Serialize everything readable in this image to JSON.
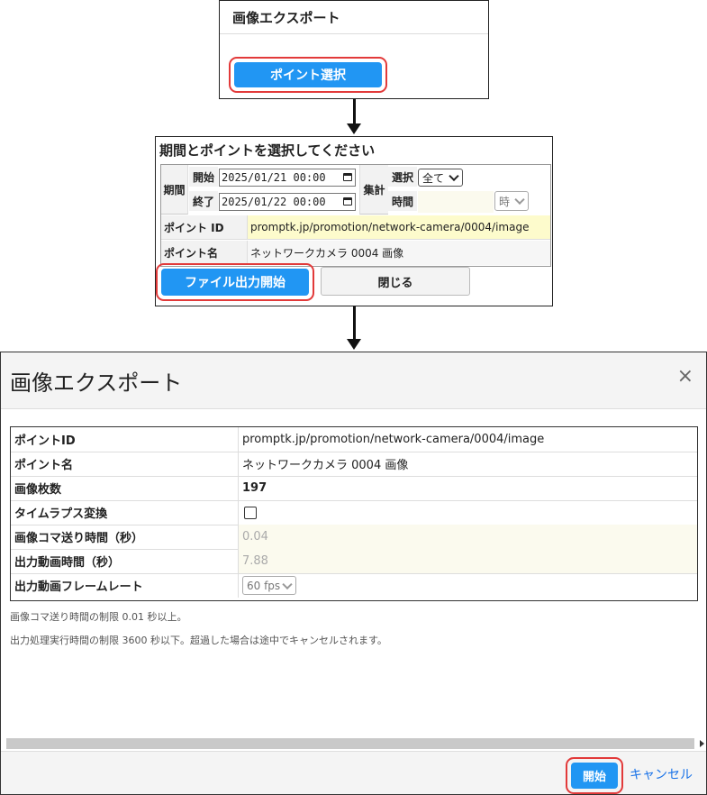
{
  "panel1": {
    "title": "画像エクスポート",
    "button": "ポイント選択"
  },
  "panel2": {
    "title": "期間とポイントを選択してください",
    "period_label": "期間",
    "start_label": "開始",
    "end_label": "終了",
    "start_value": "2025/01/21 00:00",
    "end_value": "2025/01/22 00:00",
    "aggregate_label": "集計",
    "select_label": "選択",
    "select_value": "全て",
    "time_label": "時間",
    "time_unit": "時",
    "point_id_label": "ポイント ID",
    "point_id_value": "promptk.jp/promotion/network-camera/0004/image",
    "point_name_label": "ポイント名",
    "point_name_value": "ネットワークカメラ 0004 画像",
    "start_button": "ファイル出力開始",
    "close_button": "閉じる"
  },
  "dialog": {
    "title": "画像エクスポート",
    "close_symbol": "×",
    "rows": [
      {
        "key": "ポイントID",
        "value": "promptk.jp/promotion/network-camera/0004/image"
      },
      {
        "key": "ポイント名",
        "value": "ネットワークカメラ 0004 画像"
      },
      {
        "key": "画像枚数",
        "value": "197"
      },
      {
        "key": "タイムラプス変換",
        "value": ""
      },
      {
        "key": "画像コマ送り時間（秒）",
        "value": "0.04"
      },
      {
        "key": "出力動画時間（秒）",
        "value": "7.88"
      },
      {
        "key": "出力動画フレームレート",
        "value": "60 fps"
      }
    ],
    "note1": "画像コマ送り時間の制限 0.01 秒以上。",
    "note2": "出力処理実行時間の制限 3600 秒以下。超過した場合は途中でキャンセルされます。",
    "start_button": "開始",
    "cancel_link": "キャンセル"
  },
  "colors": {
    "accent": "#2196f3",
    "highlight_border": "#e23a3a",
    "point_id_bg": "#fdfbcc"
  }
}
